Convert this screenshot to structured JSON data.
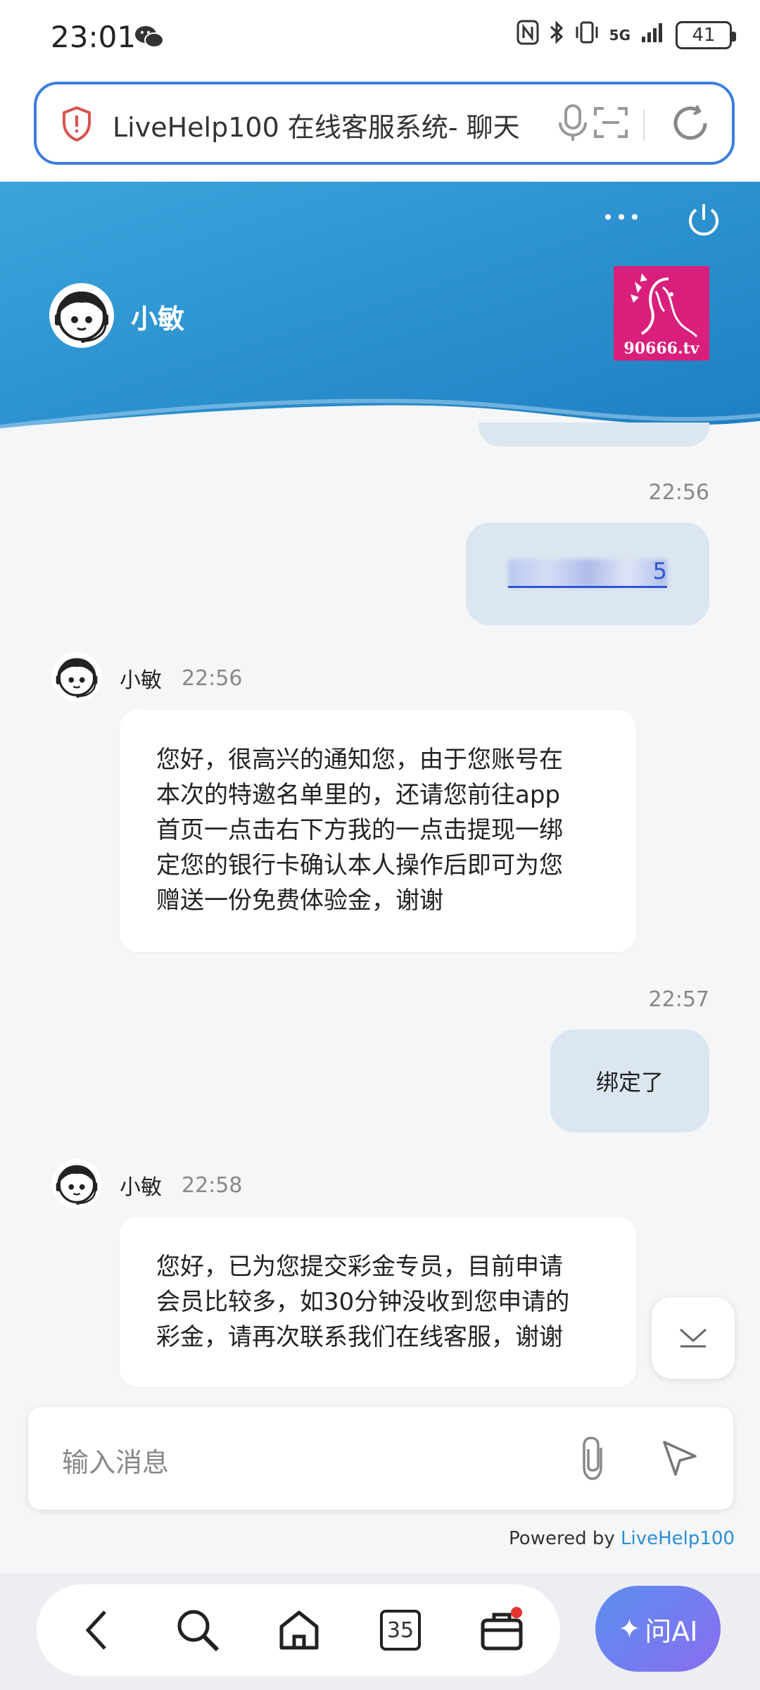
{
  "status_bar": {
    "time": "23:01",
    "network": "5G",
    "battery": "41"
  },
  "browser": {
    "url_text": "LiveHelp100 在线客服系统- 聊天"
  },
  "chat_header": {
    "agent_name": "小敏",
    "logo_text": "90666.tv"
  },
  "messages": [
    {
      "from": "user",
      "time": "22:56",
      "link_tail": "5"
    },
    {
      "from": "agent",
      "name": "小敏",
      "time": "22:56",
      "lines": [
        "您好，很高兴的通知您，由于您账号在",
        "本次的特邀名单里的，还请您前往app",
        "首页一点击右下方我的一点击提现一绑",
        "定您的银行卡确认本人操作后即可为您",
        "赠送一份免费体验金，谢谢"
      ]
    },
    {
      "from": "user",
      "time": "22:57",
      "text": "绑定了"
    },
    {
      "from": "agent",
      "name": "小敏",
      "time": "22:58",
      "lines": [
        "您好，已为您提交彩金专员，目前申请",
        "会员比较多，如30分钟没收到您申请的",
        "彩金，请再次联系我们在线客服，谢谢"
      ]
    }
  ],
  "input": {
    "placeholder": "输入消息"
  },
  "footer": {
    "powered_prefix": "Powered by ",
    "powered_brand": "LiveHelp100"
  },
  "bottom_nav": {
    "tab_count": "35",
    "ai_label": "问AI"
  },
  "colors": {
    "accent": "#3b7ee0",
    "header_blue": "#2a8fd0",
    "user_bubble": "#dbe6f0",
    "link": "#2f55d4",
    "brand_link": "#2a8fd6"
  }
}
